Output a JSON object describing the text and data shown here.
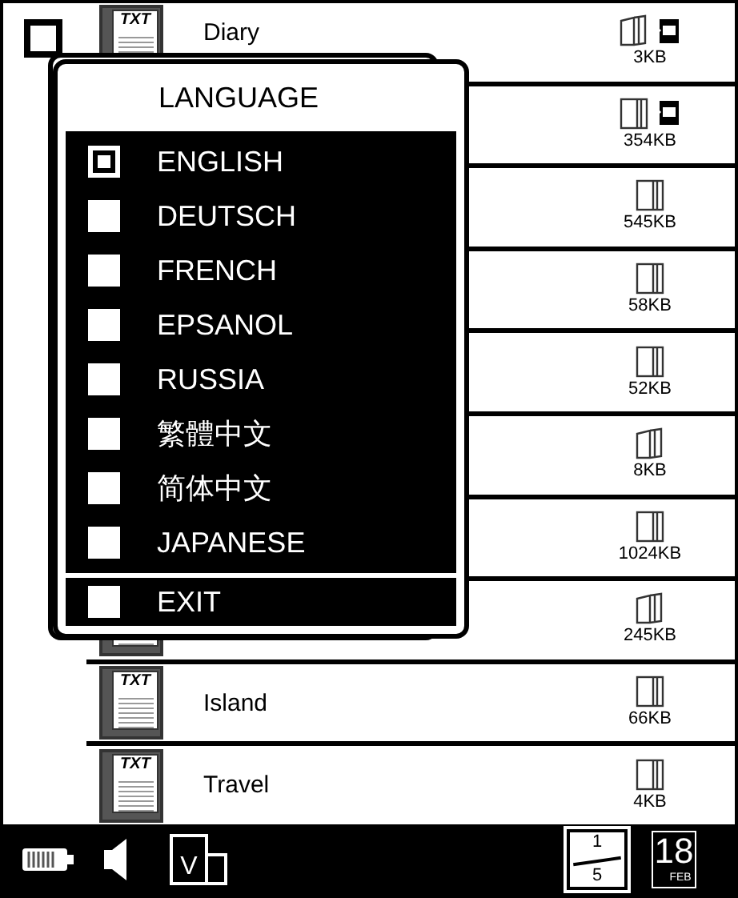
{
  "select_checkbox": {
    "checked": false
  },
  "files": [
    {
      "name": "Diary",
      "icon_label": "TXT",
      "kind": "open",
      "sd": true,
      "size": "3KB"
    },
    {
      "kind": "closed",
      "sd": true,
      "size": "354KB"
    },
    {
      "kind": "closed",
      "sd": false,
      "size": "545KB"
    },
    {
      "kind": "closed",
      "sd": false,
      "size": "58KB"
    },
    {
      "kind": "closed",
      "sd": false,
      "size": "52KB"
    },
    {
      "kind": "open",
      "sd": false,
      "size": "8KB"
    },
    {
      "kind": "closed",
      "sd": false,
      "size": "1024KB"
    },
    {
      "kind": "open",
      "sd": false,
      "size": "245KB"
    },
    {
      "name": "Island",
      "icon_label": "TXT",
      "kind": "closed",
      "sd": false,
      "size": "66KB"
    },
    {
      "name": "Travel",
      "icon_label": "TXT",
      "kind": "closed",
      "sd": false,
      "size": "4KB"
    }
  ],
  "language_dialog": {
    "title": "LANGUAGE",
    "options": [
      {
        "label": "ENGLISH",
        "selected": true
      },
      {
        "label": "DEUTSCH",
        "selected": false
      },
      {
        "label": "FRENCH",
        "selected": false
      },
      {
        "label": "EPSANOL",
        "selected": false
      },
      {
        "label": "RUSSIA",
        "selected": false
      },
      {
        "label": "繁體中文",
        "selected": false
      },
      {
        "label": "简体中文",
        "selected": false
      },
      {
        "label": "JAPANESE",
        "selected": false
      }
    ],
    "exit": "EXIT"
  },
  "status_bar": {
    "view_letter": "V",
    "page": "1",
    "pages": "5",
    "day": "18",
    "month": "FEB"
  }
}
